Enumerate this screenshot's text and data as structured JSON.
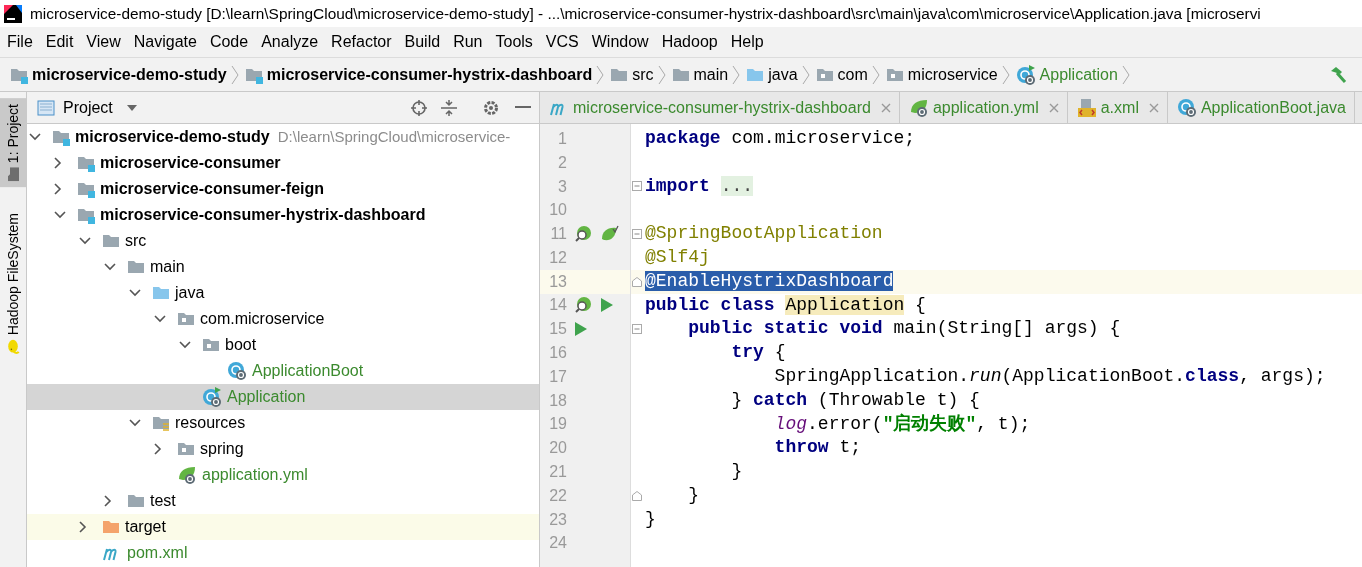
{
  "window": {
    "title": "microservice-demo-study [D:\\learn\\SpringCloud\\microservice-demo-study] - ...\\microservice-consumer-hystrix-dashboard\\src\\main\\java\\com\\microservice\\Application.java [microservi"
  },
  "menu": [
    {
      "label": "File"
    },
    {
      "label": "Edit"
    },
    {
      "label": "View"
    },
    {
      "label": "Navigate"
    },
    {
      "label": "Code"
    },
    {
      "label": "Analyze"
    },
    {
      "label": "Refactor"
    },
    {
      "label": "Build"
    },
    {
      "label": "Run"
    },
    {
      "label": "Tools"
    },
    {
      "label": "VCS"
    },
    {
      "label": "Window"
    },
    {
      "label": "Hadoop"
    },
    {
      "label": "Help"
    }
  ],
  "breadcrumb": [
    {
      "label": "microservice-demo-study",
      "kind": "module",
      "added": false
    },
    {
      "label": "microservice-consumer-hystrix-dashboard",
      "kind": "module",
      "added": false
    },
    {
      "label": "src",
      "kind": "folder",
      "added": false
    },
    {
      "label": "main",
      "kind": "folder",
      "added": false
    },
    {
      "label": "java",
      "kind": "source-folder",
      "added": false
    },
    {
      "label": "com",
      "kind": "package",
      "added": false
    },
    {
      "label": "microservice",
      "kind": "package",
      "added": false
    },
    {
      "label": "Application",
      "kind": "main-class",
      "added": true
    }
  ],
  "tool_strip": [
    {
      "label": "1: Project",
      "kind": "folder",
      "selected": true
    },
    {
      "label": "Hadoop FileSystem",
      "kind": "elephant",
      "selected": false
    }
  ],
  "project_panel": {
    "title": "Project",
    "tree": [
      {
        "label": "microservice-demo-study",
        "kind": "module",
        "path": "D:\\learn\\SpringCloud\\microservice-",
        "expanded": true,
        "selected": false,
        "added": false,
        "children": [
          {
            "label": "microservice-consumer",
            "kind": "module",
            "expanded": false,
            "selected": false,
            "added": false
          },
          {
            "label": "microservice-consumer-feign",
            "kind": "module",
            "expanded": false,
            "selected": false,
            "added": false
          },
          {
            "label": "microservice-consumer-hystrix-dashboard",
            "kind": "module",
            "expanded": true,
            "selected": false,
            "added": false,
            "children": [
              {
                "label": "src",
                "kind": "folder",
                "expanded": true,
                "selected": false,
                "added": false,
                "children": [
                  {
                    "label": "main",
                    "kind": "folder",
                    "expanded": true,
                    "selected": false,
                    "added": false,
                    "children": [
                      {
                        "label": "java",
                        "kind": "source-folder",
                        "expanded": true,
                        "selected": false,
                        "added": false,
                        "children": [
                          {
                            "label": "com.microservice",
                            "kind": "package",
                            "expanded": true,
                            "selected": false,
                            "added": false,
                            "children": [
                              {
                                "label": "boot",
                                "kind": "package",
                                "expanded": true,
                                "selected": false,
                                "added": false,
                                "children": [
                                  {
                                    "label": "ApplicationBoot",
                                    "kind": "class",
                                    "added": true,
                                    "selected": false
                                  }
                                ]
                              },
                              {
                                "label": "Application",
                                "kind": "main-class",
                                "added": true,
                                "selected": true
                              }
                            ]
                          }
                        ]
                      },
                      {
                        "label": "resources",
                        "kind": "resources",
                        "expanded": true,
                        "selected": false,
                        "added": false,
                        "children": [
                          {
                            "label": "spring",
                            "kind": "package",
                            "expanded": false,
                            "selected": false,
                            "added": false
                          },
                          {
                            "label": "application.yml",
                            "kind": "yml",
                            "added": true,
                            "selected": false
                          }
                        ]
                      }
                    ]
                  },
                  {
                    "label": "test",
                    "kind": "folder",
                    "expanded": false,
                    "selected": false,
                    "added": false
                  }
                ]
              },
              {
                "label": "target",
                "kind": "excluded",
                "expanded": false,
                "selected": false,
                "added": false
              },
              {
                "label": "pom.xml",
                "kind": "maven",
                "added": true,
                "selected": false
              }
            ]
          }
        ]
      }
    ]
  },
  "editor": {
    "tabs": [
      {
        "label": "microservice-consumer-hystrix-dashboard",
        "kind": "maven",
        "added": true,
        "closable": true,
        "selected": false
      },
      {
        "label": "application.yml",
        "kind": "yml",
        "added": true,
        "closable": true,
        "selected": false
      },
      {
        "label": "a.xml",
        "kind": "xml",
        "added": true,
        "closable": true,
        "selected": false
      },
      {
        "label": "ApplicationBoot.java",
        "kind": "class",
        "added": true,
        "closable": false,
        "selected": false
      }
    ],
    "lines": [
      {
        "number": "1",
        "tokens": [
          {
            "text": "package",
            "kind": "keyword"
          },
          {
            "text": " com.microservice;",
            "kind": "plain"
          }
        ]
      },
      {
        "number": "2"
      },
      {
        "number": "3",
        "fold_open": true,
        "tokens": [
          {
            "text": "import ",
            "kind": "keyword"
          },
          {
            "text": "...",
            "kind": "folded"
          }
        ]
      },
      {
        "number": "10"
      },
      {
        "number": "11",
        "fold_open": true,
        "gutter_icons": [
          {
            "kind": "bean"
          },
          {
            "kind": "spring"
          }
        ],
        "tokens": [
          {
            "text": "@SpringBootApplication",
            "kind": "annotation"
          }
        ]
      },
      {
        "number": "12",
        "tokens": [
          {
            "text": "@Slf4j",
            "kind": "annotation"
          }
        ]
      },
      {
        "number": "13",
        "fold_close": true,
        "current": true,
        "tokens": [
          {
            "text": "@EnableHystrixDashboard",
            "kind": "selected"
          }
        ]
      },
      {
        "number": "14",
        "gutter_icons": [
          {
            "kind": "bean"
          },
          {
            "kind": "run"
          }
        ],
        "tokens": [
          {
            "text": "public class ",
            "kind": "keyword"
          },
          {
            "text": "Application",
            "kind": "highlight"
          },
          {
            "text": " {",
            "kind": "plain"
          }
        ]
      },
      {
        "number": "15",
        "fold_open": true,
        "gutter_icons": [
          {
            "kind": "run"
          }
        ],
        "tokens": [
          {
            "text": "    public static void",
            "kind": "keyword"
          },
          {
            "text": " main(String[] args) {",
            "kind": "plain"
          }
        ]
      },
      {
        "number": "16",
        "tokens": [
          {
            "text": "        try",
            "kind": "keyword"
          },
          {
            "text": " {",
            "kind": "plain"
          }
        ]
      },
      {
        "number": "17",
        "tokens": [
          {
            "text": "            SpringApplication.",
            "kind": "plain"
          },
          {
            "text": "run",
            "kind": "static"
          },
          {
            "text": "(ApplicationBoot.",
            "kind": "plain"
          },
          {
            "text": "class",
            "kind": "keyword"
          },
          {
            "text": ", args);",
            "kind": "plain"
          }
        ]
      },
      {
        "number": "18",
        "tokens": [
          {
            "text": "        } ",
            "kind": "plain"
          },
          {
            "text": "catch",
            "kind": "keyword"
          },
          {
            "text": " (Throwable t) {",
            "kind": "plain"
          }
        ]
      },
      {
        "number": "19",
        "tokens": [
          {
            "text": "            log",
            "kind": "field"
          },
          {
            "text": ".error(",
            "kind": "plain"
          },
          {
            "text": "\"启动失败\"",
            "kind": "string"
          },
          {
            "text": ", t);",
            "kind": "plain"
          }
        ]
      },
      {
        "number": "20",
        "tokens": [
          {
            "text": "            throw",
            "kind": "keyword"
          },
          {
            "text": " t;",
            "kind": "plain"
          }
        ]
      },
      {
        "number": "21",
        "tokens": [
          {
            "text": "        }",
            "kind": "plain"
          }
        ]
      },
      {
        "number": "22",
        "fold_close": true,
        "tokens": [
          {
            "text": "    }",
            "kind": "plain"
          }
        ]
      },
      {
        "number": "23",
        "tokens": [
          {
            "text": "}",
            "kind": "plain"
          }
        ]
      },
      {
        "number": "24"
      }
    ]
  }
}
